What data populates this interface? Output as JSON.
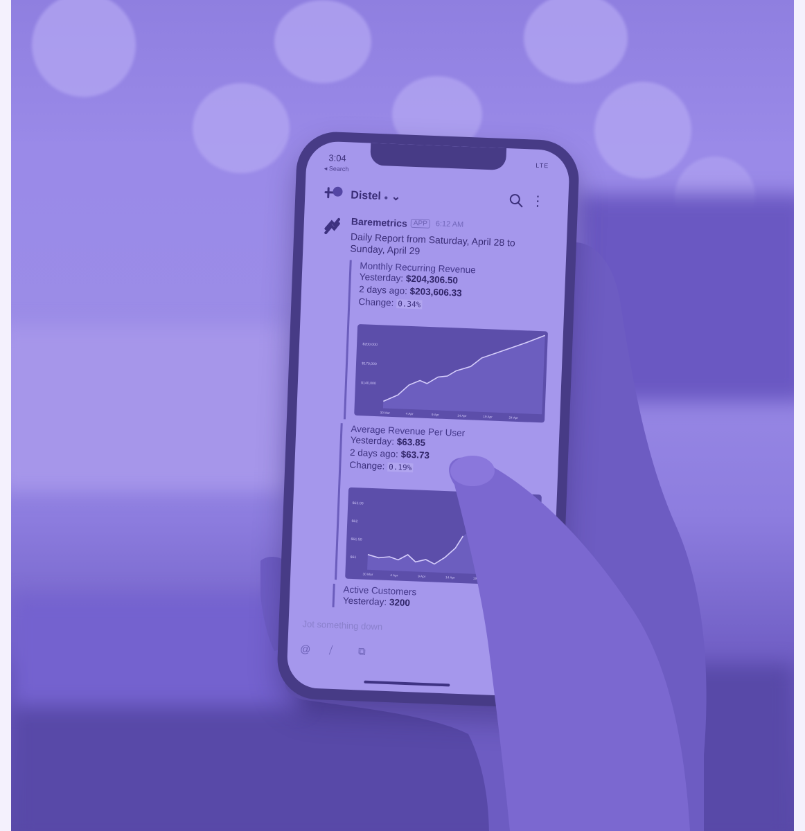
{
  "phone": {
    "status_time": "3:04",
    "status_right": "LTE",
    "back_label": "◂ Search",
    "channel_name": "Distel",
    "channel_dot": "●",
    "channel_chevron": "⌄"
  },
  "message": {
    "sender": "Baremetrics",
    "app_badge": "APP",
    "time": "6:12 AM",
    "report": "Daily Report from Saturday, April 28 to Sunday, April 29"
  },
  "cards": [
    {
      "title": "Monthly Recurring Revenue",
      "yesterday_label": "Yesterday:",
      "yesterday_value": "$204,306.50",
      "two_days_label": "2 days ago:",
      "two_days_value": "$203,606.33",
      "change_label": "Change:",
      "change_value": "0.34%",
      "chart_ticks": [
        "$200,000",
        "$170,000",
        "$140,000"
      ],
      "chart_x": [
        "30 Mar",
        "4 Apr",
        "9 Apr",
        "14 Apr",
        "19 Apr",
        "24 Apr"
      ]
    },
    {
      "title": "Average Revenue Per User",
      "yesterday_label": "Yesterday:",
      "yesterday_value": "$63.85",
      "two_days_label": "2 days ago:",
      "two_days_value": "$63.73",
      "change_label": "Change:",
      "change_value": "0.19%",
      "chart_ticks": [
        "$63.00",
        "$62",
        "$61.50",
        "$61"
      ],
      "chart_x": [
        "30 Mar",
        "4 Apr",
        "9 Apr",
        "14 Apr",
        "19 Apr"
      ]
    },
    {
      "title": "Active Customers",
      "yesterday_label": "Yesterday:",
      "yesterday_value": "3200"
    }
  ],
  "composer": {
    "placeholder": "Jot something down"
  },
  "icons": [
    "slack-logo-icon",
    "search-icon",
    "more-icon",
    "baremetrics-logo-icon",
    "mention-icon",
    "slash-icon",
    "attach-icon",
    "image-icon"
  ],
  "colors": {
    "tint": "#9b8ce7",
    "deep": "#5b4aa9",
    "page_bg": "#f4f1fd"
  }
}
